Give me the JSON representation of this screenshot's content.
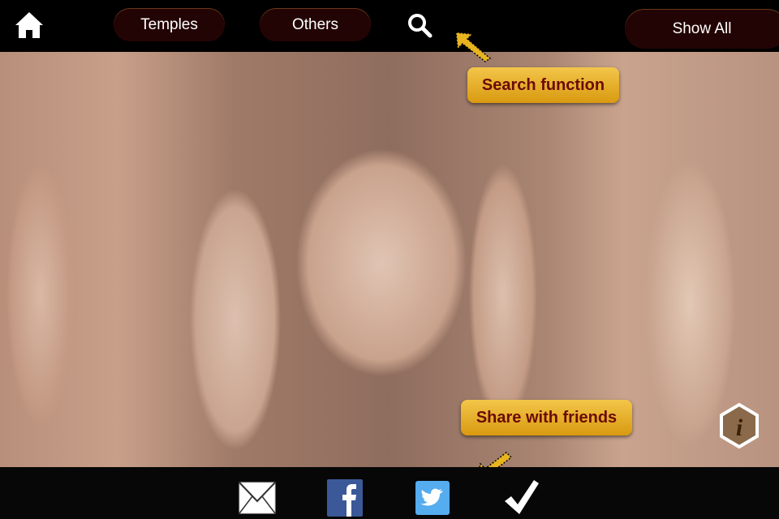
{
  "top_bar": {
    "home_icon": "home-icon",
    "tabs": [
      {
        "label": "Temples"
      },
      {
        "label": "Others"
      }
    ],
    "search_icon": "search-icon",
    "show_all_label": "Show All"
  },
  "tooltips": {
    "search": "Search function",
    "share": "Share with friends"
  },
  "photo": {
    "info_icon": "info-icon"
  },
  "share_bar": {
    "icons": [
      "mail-icon",
      "facebook-icon",
      "twitter-icon",
      "checkmark-icon"
    ]
  },
  "colors": {
    "pill": "#230404",
    "tooltip": "#e8ae2a",
    "tooltip_text": "#6b0b07",
    "facebook": "#3b5998",
    "twitter": "#55acee"
  }
}
